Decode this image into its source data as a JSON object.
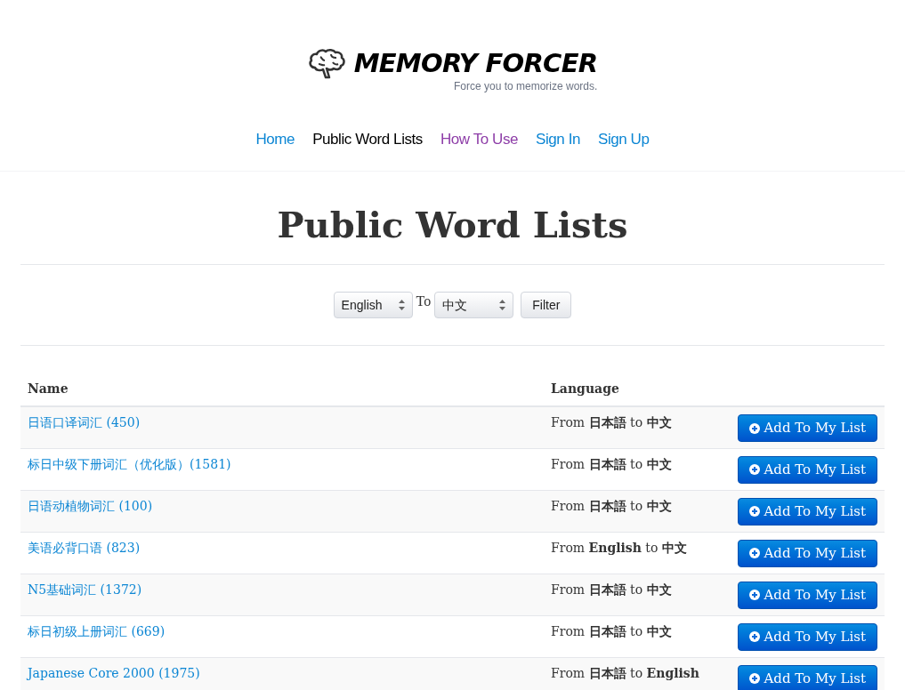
{
  "logo": {
    "title": "MEMORY FORCER",
    "tagline": "Force you to memorize words."
  },
  "nav": [
    {
      "label": "Home",
      "selected": false,
      "visited": false
    },
    {
      "label": "Public Word Lists",
      "selected": true,
      "visited": false
    },
    {
      "label": "How To Use",
      "selected": false,
      "visited": true
    },
    {
      "label": "Sign In",
      "selected": false,
      "visited": false
    },
    {
      "label": "Sign Up",
      "selected": false,
      "visited": false
    }
  ],
  "heading": "Public Word Lists",
  "filter": {
    "from": "English",
    "to_label": "To",
    "to": "中文",
    "button": "Filter"
  },
  "table": {
    "columns": [
      "Name",
      "Language"
    ],
    "rows": [
      {
        "name": "日语口译词汇 (450)",
        "language": "From **日本語** to **中文**",
        "action": "Add To My List"
      },
      {
        "name": "标日中级下册词汇（优化版）(1581)",
        "language": "From **日本語** to **中文**",
        "action": "Add To My List"
      },
      {
        "name": "日语动植物词汇 (100)",
        "language": "From **日本語** to **中文**",
        "action": "Add To My List"
      },
      {
        "name": "美语必背口语 (823)",
        "language": "From **English** to **中文**",
        "action": "Add To My List"
      },
      {
        "name": "N5基础词汇 (1372)",
        "language": "From **日本語** to **中文**",
        "action": "Add To My List"
      },
      {
        "name": "标日初级上册词汇 (669)",
        "language": "From **日本語** to **中文**",
        "action": "Add To My List"
      },
      {
        "name": "Japanese Core 2000 (1975)",
        "language": "From **日本語** to **English**",
        "action": "Add To My List"
      }
    ]
  }
}
